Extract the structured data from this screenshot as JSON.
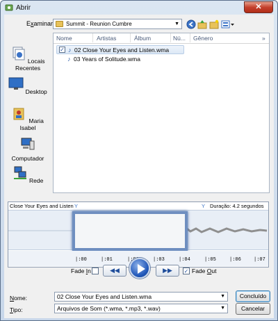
{
  "window": {
    "title": "Abrir",
    "close_glyph": "✕"
  },
  "toolbar": {
    "lookin_label_pre": "E",
    "lookin_label_u": "x",
    "lookin_label_post": "aminar:",
    "lookin_value": "Summit - Reunion Cumbre",
    "icons": [
      "back-icon",
      "up-folder-icon",
      "new-folder-icon",
      "views-icon"
    ]
  },
  "places": [
    {
      "label": "Locais Recentes",
      "icon": "recent-places-icon"
    },
    {
      "label": "Desktop",
      "icon": "desktop-icon"
    },
    {
      "label": "Maria Isabel",
      "icon": "user-folder-icon"
    },
    {
      "label": "Computador",
      "icon": "computer-icon"
    },
    {
      "label": "Rede",
      "icon": "network-icon"
    }
  ],
  "filelist": {
    "columns": [
      "Nome",
      "Artistas",
      "Álbum",
      "Nú...",
      "Gênero"
    ],
    "more": "»",
    "files": [
      {
        "name": "02 Close Your Eyes and Listen.wma",
        "checked": true,
        "selected": true
      },
      {
        "name": "03 Years of Solitude.wma",
        "checked": false,
        "selected": false
      }
    ]
  },
  "editor": {
    "track_name": "Close Your Eyes and Listen",
    "duration": "Duração: 4.2 segundos",
    "ticks": [
      "|:00",
      "|:01",
      "|:02",
      "|:03",
      "|:04",
      "|:05",
      "|:06",
      "|:07"
    ]
  },
  "playback": {
    "fade_in_pre": "Fade ",
    "fade_in_u": "I",
    "fade_in_post": "n",
    "fade_in_checked": false,
    "rewind_glyph": "◀◀",
    "forward_glyph": "▶▶",
    "fade_out_pre": "Fade ",
    "fade_out_u": "O",
    "fade_out_post": "ut",
    "fade_out_checked": true
  },
  "form": {
    "name_label_u": "N",
    "name_label_post": "ome:",
    "name_value": "02 Close Your Eyes and Listen.wma",
    "type_label_u": "T",
    "type_label_post": "ipo:",
    "type_value": "Arquivos de Som (*.wma, *.mp3, *.wav)",
    "ok_label": "Concluído",
    "cancel_label": "Cancelar"
  },
  "colors": {
    "accent": "#1f56b8",
    "selection_border": "#6f8fc0",
    "waveform": "#9a9a9a"
  }
}
